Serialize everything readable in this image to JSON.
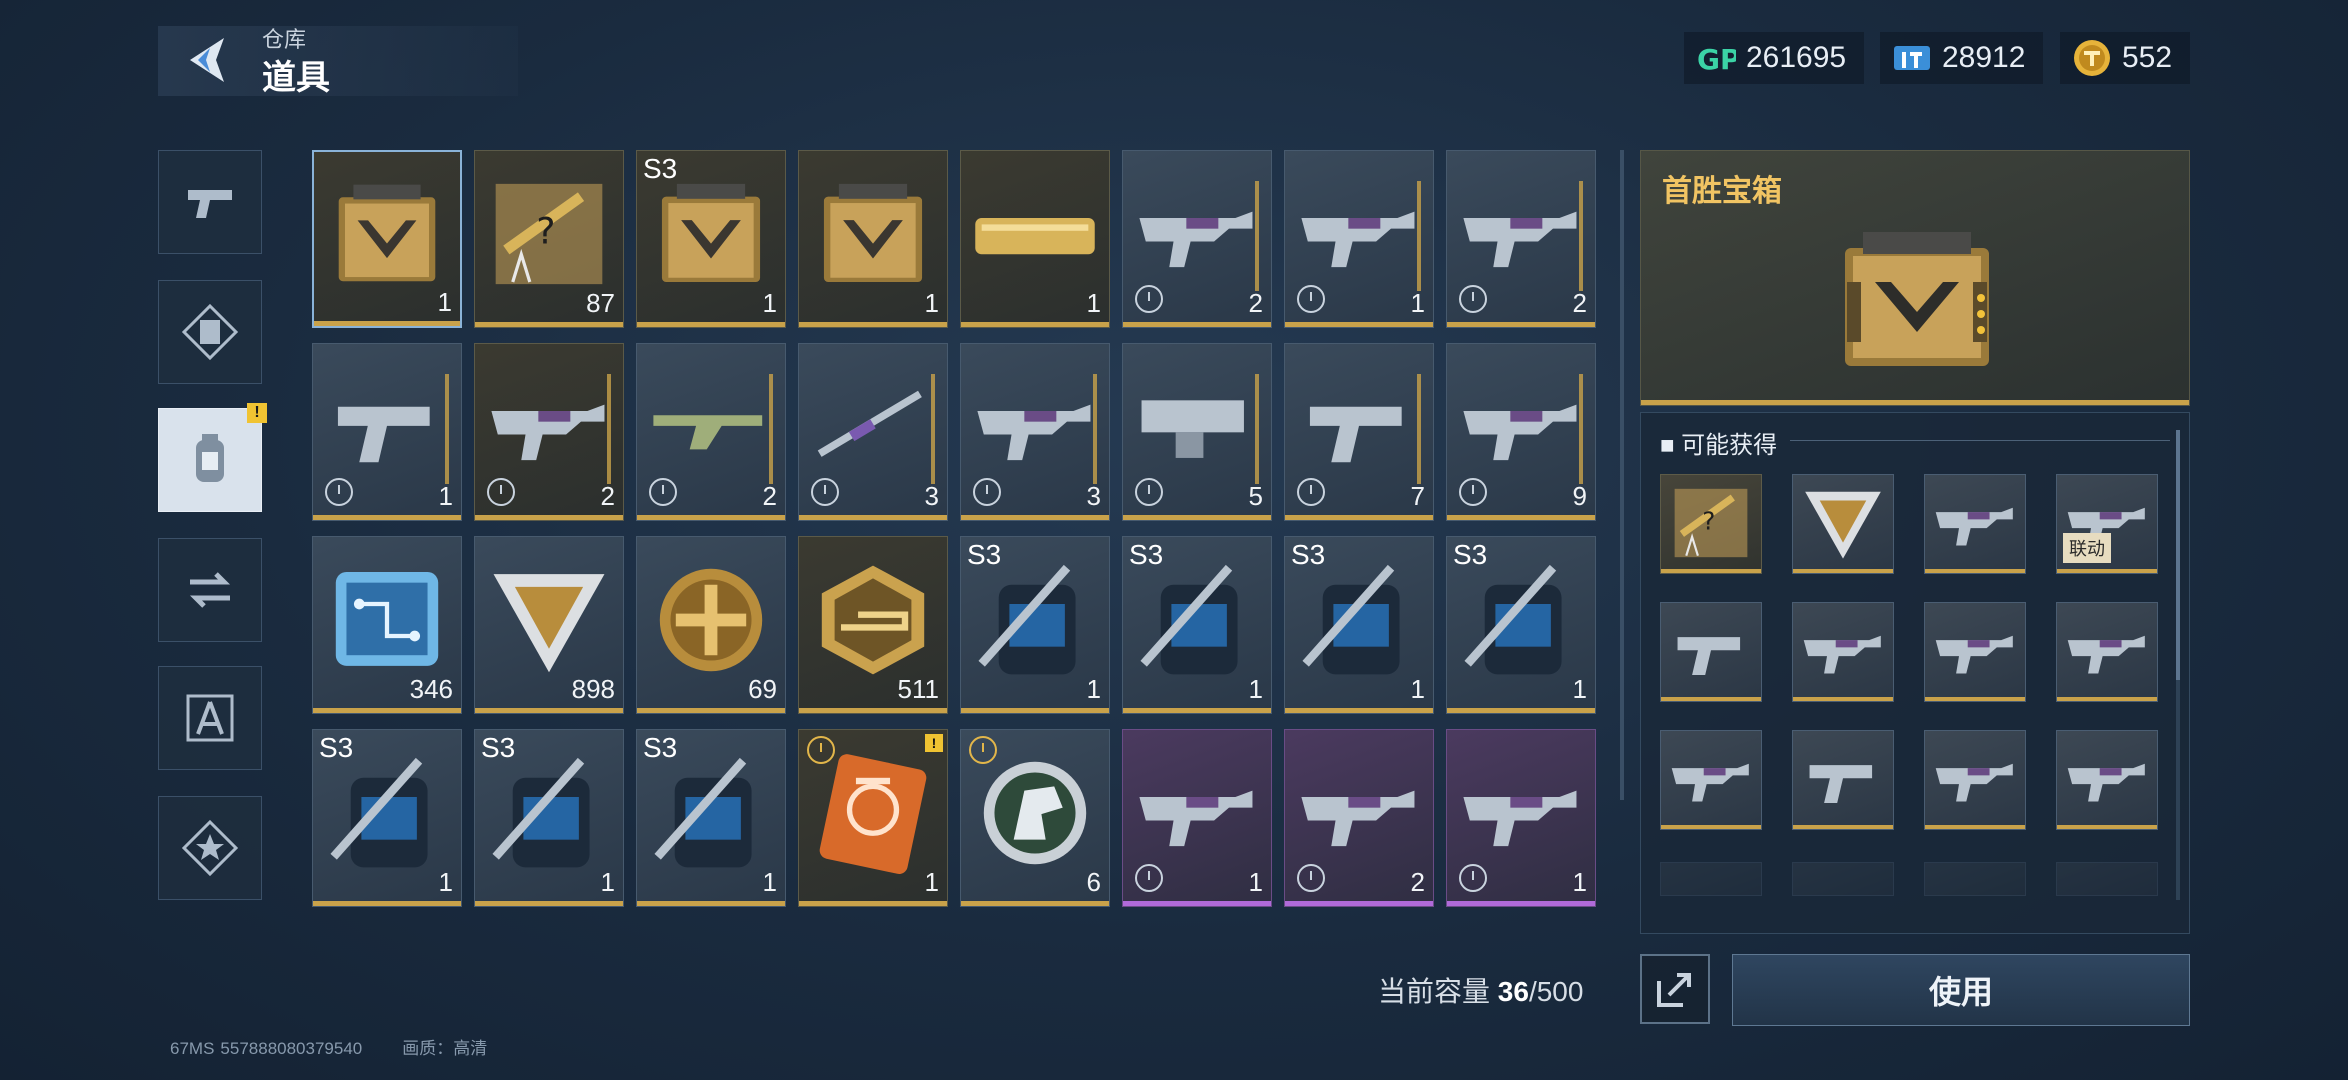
{
  "header": {
    "subtitle": "仓库",
    "title": "道具"
  },
  "currencies": [
    {
      "icon": "gp-icon",
      "value": "261695"
    },
    {
      "icon": "ticket-icon",
      "value": "28912"
    },
    {
      "icon": "gold-coin-icon",
      "value": "552"
    }
  ],
  "tabs": [
    {
      "name": "tab-weapons",
      "icon": "pistol-icon",
      "active": false
    },
    {
      "name": "tab-cards",
      "icon": "card-icon",
      "active": false
    },
    {
      "name": "tab-items",
      "icon": "canister-icon",
      "active": true,
      "badge": "!"
    },
    {
      "name": "tab-exchange",
      "icon": "exchange-icon",
      "active": false
    },
    {
      "name": "tab-blueprint",
      "icon": "blueprint-icon",
      "active": false
    },
    {
      "name": "tab-favorites",
      "icon": "star-icon",
      "active": false
    }
  ],
  "items": [
    {
      "art": "chest-icon",
      "qty": "1",
      "style": "gold",
      "selected": true
    },
    {
      "art": "blueprint-box-icon",
      "qty": "87",
      "style": "gold"
    },
    {
      "art": "chest-icon",
      "qty": "1",
      "style": "gold",
      "tag": "S3"
    },
    {
      "art": "chest-icon",
      "qty": "1",
      "style": "gold"
    },
    {
      "art": "case-icon",
      "qty": "1",
      "style": "gold"
    },
    {
      "art": "rifle-icon",
      "qty": "2",
      "style": "grey",
      "timed": true,
      "stripe": true
    },
    {
      "art": "rifle-icon",
      "qty": "1",
      "style": "grey",
      "timed": true,
      "stripe": true
    },
    {
      "art": "rifle-icon",
      "qty": "2",
      "style": "grey",
      "timed": true,
      "stripe": true
    },
    {
      "art": "pistol-icon",
      "qty": "1",
      "style": "grey",
      "timed": true,
      "stripe": true
    },
    {
      "art": "rifle-icon",
      "qty": "2",
      "style": "gold",
      "timed": true,
      "stripe": true
    },
    {
      "art": "shotgun-icon",
      "qty": "2",
      "style": "grey",
      "timed": true,
      "stripe": true
    },
    {
      "art": "sniper-icon",
      "qty": "3",
      "style": "grey",
      "timed": true,
      "stripe": true
    },
    {
      "art": "rifle-icon",
      "qty": "3",
      "style": "grey",
      "timed": true,
      "stripe": true
    },
    {
      "art": "lmg-icon",
      "qty": "5",
      "style": "grey",
      "timed": true,
      "stripe": true
    },
    {
      "art": "pistol-icon",
      "qty": "7",
      "style": "grey",
      "timed": true,
      "stripe": true
    },
    {
      "art": "rifle-icon",
      "qty": "9",
      "style": "grey",
      "timed": true,
      "stripe": true
    },
    {
      "art": "chip-icon",
      "qty": "346",
      "style": "grey"
    },
    {
      "art": "triangle-token-icon",
      "qty": "898",
      "style": "grey"
    },
    {
      "art": "medal-icon",
      "qty": "69",
      "style": "grey"
    },
    {
      "art": "hex-badge-icon",
      "qty": "511",
      "style": "gold"
    },
    {
      "art": "backpack-icon",
      "qty": "1",
      "style": "grey",
      "tag": "S3"
    },
    {
      "art": "backpack-icon",
      "qty": "1",
      "style": "grey",
      "tag": "S3"
    },
    {
      "art": "backpack-icon",
      "qty": "1",
      "style": "grey",
      "tag": "S3"
    },
    {
      "art": "backpack-icon",
      "qty": "1",
      "style": "grey",
      "tag": "S3"
    },
    {
      "art": "backpack-icon",
      "qty": "1",
      "style": "grey",
      "tag": "S3"
    },
    {
      "art": "backpack-icon",
      "qty": "1",
      "style": "grey",
      "tag": "S3"
    },
    {
      "art": "backpack-icon",
      "qty": "1",
      "style": "grey",
      "tag": "S3"
    },
    {
      "art": "orange-card-icon",
      "qty": "1",
      "style": "gold",
      "timedTop": true,
      "warn": "!"
    },
    {
      "art": "horse-emblem-icon",
      "qty": "6",
      "style": "grey",
      "timedTop": true
    },
    {
      "art": "rifle-icon",
      "qty": "1",
      "style": "purple",
      "timed": true
    },
    {
      "art": "rifle-icon",
      "qty": "2",
      "style": "purple",
      "timed": true
    },
    {
      "art": "rifle-icon",
      "qty": "1",
      "style": "purple",
      "timed": true
    }
  ],
  "detail": {
    "title": "首胜宝箱",
    "possible_label": "可能获得",
    "rewards": [
      {
        "art": "blueprint-box-icon",
        "style": "gold"
      },
      {
        "art": "triangle-token-icon",
        "style": "grey"
      },
      {
        "art": "rifle-icon",
        "style": "grey"
      },
      {
        "art": "rifle-icon",
        "style": "grey",
        "tag": "联动"
      },
      {
        "art": "pistol-icon",
        "style": "grey"
      },
      {
        "art": "rifle-icon",
        "style": "grey"
      },
      {
        "art": "rifle-icon",
        "style": "grey"
      },
      {
        "art": "rifle-icon",
        "style": "grey"
      },
      {
        "art": "rifle-icon",
        "style": "grey"
      },
      {
        "art": "pistol-icon",
        "style": "grey"
      },
      {
        "art": "rifle-icon",
        "style": "grey"
      },
      {
        "art": "rifle-icon",
        "style": "grey"
      }
    ]
  },
  "footer": {
    "capacity_label": "当前容量",
    "capacity_used": "36",
    "capacity_total": "/500",
    "use_label": "使用",
    "ping": "67MS",
    "uid": "557888080379540",
    "quality": "画质：高清"
  },
  "colors": {
    "accent_gold": "#c9a24a",
    "title_gold": "#f1c463",
    "rare_purple": "#b06ad9"
  }
}
